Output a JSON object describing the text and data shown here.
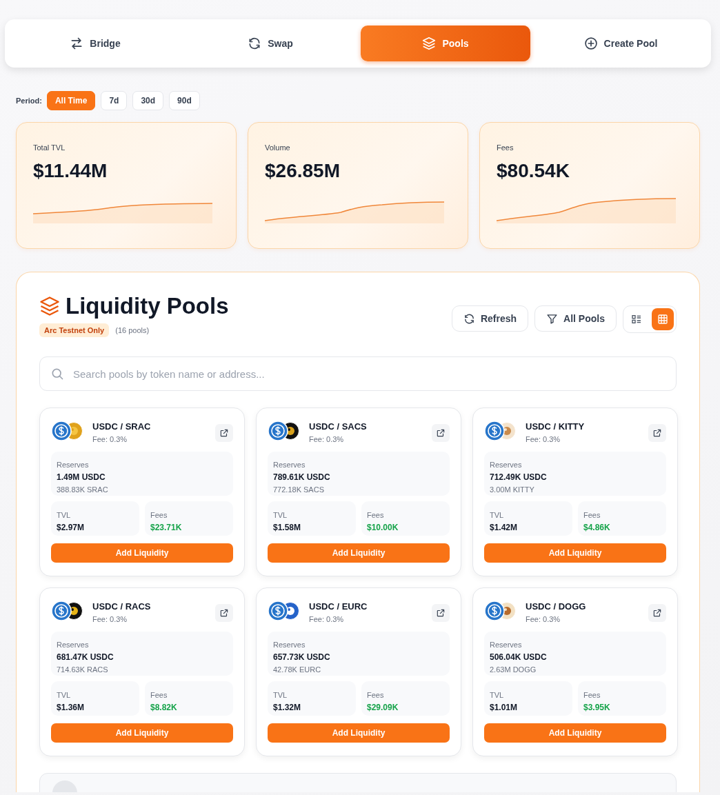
{
  "nav_tabs": [
    {
      "label": "Bridge",
      "kind": "arrows",
      "selected": false
    },
    {
      "label": "Swap",
      "kind": "refresh",
      "selected": false
    },
    {
      "label": "Pools",
      "kind": "layers",
      "selected": true
    },
    {
      "label": "Create Pool",
      "kind": "plus",
      "selected": false
    }
  ],
  "period": {
    "label": "Period:",
    "options": [
      {
        "label": "All Time",
        "selected": true
      },
      {
        "label": "7d",
        "selected": false
      },
      {
        "label": "30d",
        "selected": false
      },
      {
        "label": "90d",
        "selected": false
      }
    ]
  },
  "stats": [
    {
      "label": "Total TVL",
      "value": "$11.44M"
    },
    {
      "label": "Volume",
      "value": "$26.85M"
    },
    {
      "label": "Fees",
      "value": "$80.54K"
    }
  ],
  "liquidity": {
    "title": "Liquidity Pools",
    "badge": "Arc Testnet Only",
    "count": "(16 pools)",
    "buttons": [
      {
        "label": "Refresh",
        "kind": "refresh"
      },
      {
        "label": "All Pools",
        "kind": "filter"
      }
    ],
    "view_modes": [
      {
        "kind": "list",
        "selected": false
      },
      {
        "kind": "grid",
        "selected": true
      }
    ],
    "search": {
      "placeholder": "Search pools by token name or address..."
    },
    "pools": [
      {
        "pair": "USDC / SRAC",
        "fee": "Fee: 0.3%",
        "kind": "gold",
        "reserves_label": "Reserves",
        "reserve_a": "1.49M USDC",
        "reserve_b": "388.83K SRAC",
        "tvl_label": "TVL",
        "tvl": "$2.97M",
        "fees_label": "Fees",
        "fees": "$23.71K",
        "action": "Add Liquidity"
      },
      {
        "pair": "USDC / SACS",
        "fee": "Fee: 0.3%",
        "kind": "lock",
        "reserves_label": "Reserves",
        "reserve_a": "789.61K USDC",
        "reserve_b": "772.18K SACS",
        "tvl_label": "TVL",
        "tvl": "$1.58M",
        "fees_label": "Fees",
        "fees": "$10.00K",
        "action": "Add Liquidity"
      },
      {
        "pair": "USDC / KITTY",
        "fee": "Fee: 0.3%",
        "kind": "cat",
        "reserves_label": "Reserves",
        "reserve_a": "712.49K USDC",
        "reserve_b": "3.00M KITTY",
        "tvl_label": "TVL",
        "tvl": "$1.42M",
        "fees_label": "Fees",
        "fees": "$4.86K",
        "action": "Add Liquidity"
      },
      {
        "pair": "USDC / RACS",
        "fee": "Fee: 0.3%",
        "kind": "dark",
        "reserves_label": "Reserves",
        "reserve_a": "681.47K USDC",
        "reserve_b": "714.63K RACS",
        "tvl_label": "TVL",
        "tvl": "$1.36M",
        "fees_label": "Fees",
        "fees": "$8.82K",
        "action": "Add Liquidity"
      },
      {
        "pair": "USDC / EURC",
        "fee": "Fee: 0.3%",
        "kind": "euro",
        "reserves_label": "Reserves",
        "reserve_a": "657.73K USDC",
        "reserve_b": "42.78K EURC",
        "tvl_label": "TVL",
        "tvl": "$1.32M",
        "fees_label": "Fees",
        "fees": "$29.09K",
        "action": "Add Liquidity"
      },
      {
        "pair": "USDC / DOGG",
        "fee": "Fee: 0.3%",
        "kind": "dog",
        "reserves_label": "Reserves",
        "reserve_a": "506.04K USDC",
        "reserve_b": "2.63M DOGG",
        "tvl_label": "TVL",
        "tvl": "$1.01M",
        "fees_label": "Fees",
        "fees": "$3.95K",
        "action": "Add Liquidity"
      }
    ]
  }
}
